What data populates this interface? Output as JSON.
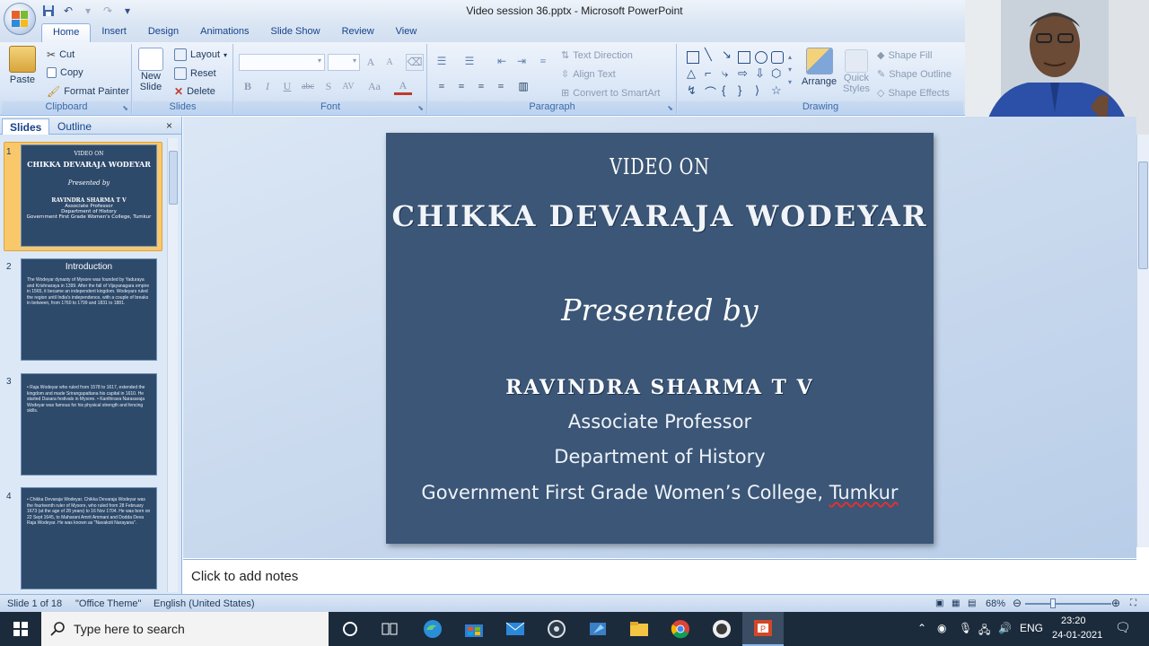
{
  "window": {
    "title": "Video session 36.pptx - Microsoft PowerPoint"
  },
  "tabs": [
    "Home",
    "Insert",
    "Design",
    "Animations",
    "Slide Show",
    "Review",
    "View"
  ],
  "ribbon": {
    "clipboard": {
      "label": "Clipboard",
      "paste": "Paste",
      "cut": "Cut",
      "copy": "Copy",
      "format_painter": "Format Painter"
    },
    "slides": {
      "label": "Slides",
      "new_slide_line1": "New",
      "new_slide_line2": "Slide",
      "layout": "Layout",
      "reset": "Reset",
      "delete": "Delete"
    },
    "font": {
      "label": "Font",
      "bold": "B",
      "italic": "I",
      "underline": "U",
      "strike": "abc",
      "shadow": "S",
      "spacing": "AV",
      "case": "Aa",
      "color": "A",
      "grow": "A",
      "shrink": "A"
    },
    "paragraph": {
      "label": "Paragraph",
      "text_direction": "Text Direction",
      "align_text": "Align Text",
      "convert_smartart": "Convert to SmartArt"
    },
    "drawing": {
      "label": "Drawing",
      "arrange": "Arrange",
      "quick_styles_line1": "Quick",
      "quick_styles_line2": "Styles",
      "shape_fill": "Shape Fill",
      "shape_outline": "Shape Outline",
      "shape_effects": "Shape Effects"
    }
  },
  "left_panel": {
    "tabs": {
      "slides": "Slides",
      "outline": "Outline"
    },
    "close": "×",
    "thumbnails": [
      {
        "num": "1",
        "lines": [
          "VIDEO ON",
          "CHIKKA DEVARAJA WODEYAR",
          "Presented by",
          "RAVINDRA SHARMA T V",
          "Associate Professor",
          "Department of History",
          "Government First Grade Women's College, Tumkur"
        ]
      },
      {
        "num": "2",
        "heading": "Introduction",
        "body": "The Wodeyar dynasty of Mysore was founded by Yaduraya and Krishnaraya in 1399. After the fall of Vijayanagara empire in 1565, it became an independent kingdom. Wodeyars ruled the region until India's independence, with a couple of breaks in between, from 1760 to 1799 and 1831 to 1881."
      },
      {
        "num": "3",
        "body": "• Raja Wodeyar who ruled from 1578 to 1617, extended the kingdom and made Srirangapattana his capital in 1610. He started Dasara festivals in Mysore. • Kanthirava Narasaraja Wodeyar was famous for his physical strength and fencing skills."
      },
      {
        "num": "4",
        "body": "• Chikka Devaraja Wodeyar. Chikka Devaraja Wodeyar was the fourteenth ruler of Mysore, who ruled from 28 February 1673 (at the age of 28 years) to 16 Nov 1704. He was born on 22 Sept 1645, to Maharani Amrit Ammani and Dodda Deva Raja Wodeyar. He was known as \"Navakoti Narayana\"."
      }
    ]
  },
  "slide": {
    "line1": "VIDEO ON",
    "line2": "CHIKKA DEVARAJA WODEYAR",
    "line3": "Presented by",
    "line4": "RAVINDRA SHARMA T V",
    "line5": "Associate Professor",
    "line6": "Department of History",
    "line7_prefix": "Government First Grade Women’s College, ",
    "line7_misspelled": "Tumkur"
  },
  "notes": {
    "placeholder": "Click to add notes"
  },
  "statusbar": {
    "slide_of": "Slide 1 of 18",
    "theme": "\"Office Theme\"",
    "language": "English (United States)",
    "zoom": "68%"
  },
  "taskbar": {
    "search_placeholder": "Type here to search",
    "language": "ENG",
    "time": "23:20",
    "date": "24-01-2021"
  },
  "colors": {
    "ribbon_blue": "#dbe6f4",
    "slide_bg": "#3b5676",
    "selection": "#f9c86b",
    "taskbar": "#1b2b3c"
  }
}
